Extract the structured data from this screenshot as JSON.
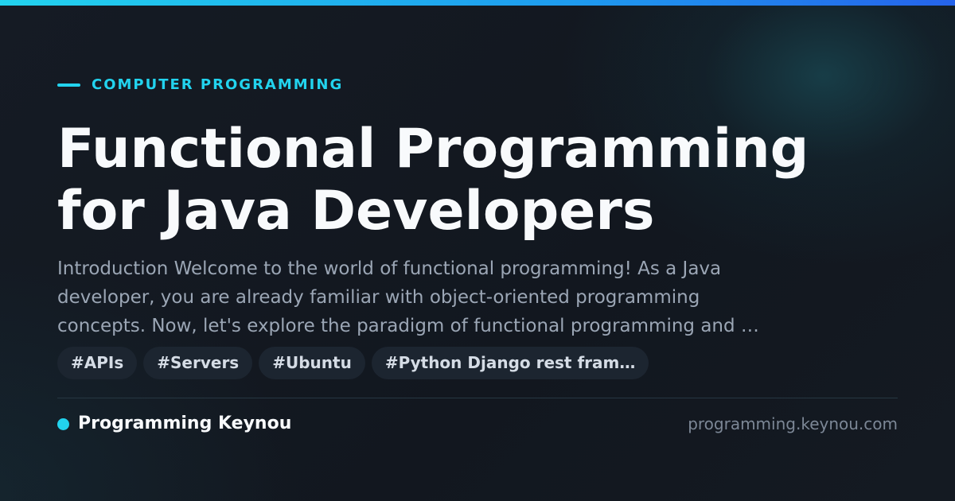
{
  "category": "COMPUTER PROGRAMMING",
  "title_lines": [
    "Functional Programming",
    "for Java Developers"
  ],
  "excerpt_lines": [
    "Introduction Welcome to the world of functional programming! As a Java",
    "developer, you are already familiar with object-oriented programming",
    "concepts. Now, let's explore the paradigm of functional programming and …"
  ],
  "tags": [
    "#APIs",
    "#Servers",
    "#Ubuntu",
    "#Python Django rest fram…"
  ],
  "brand": {
    "name": "Programming Keynou",
    "domain": "programming.keynou.com"
  },
  "colors": {
    "accent": "#22d3ee",
    "background": "#141a23",
    "title": "#f8fafc",
    "excerpt": "#9ba6b5",
    "tag_background": "#1c2530",
    "domain": "#7c8796"
  },
  "icons": {
    "eyebrow": "accent-line-icon",
    "brand": "brand-dot-icon"
  }
}
